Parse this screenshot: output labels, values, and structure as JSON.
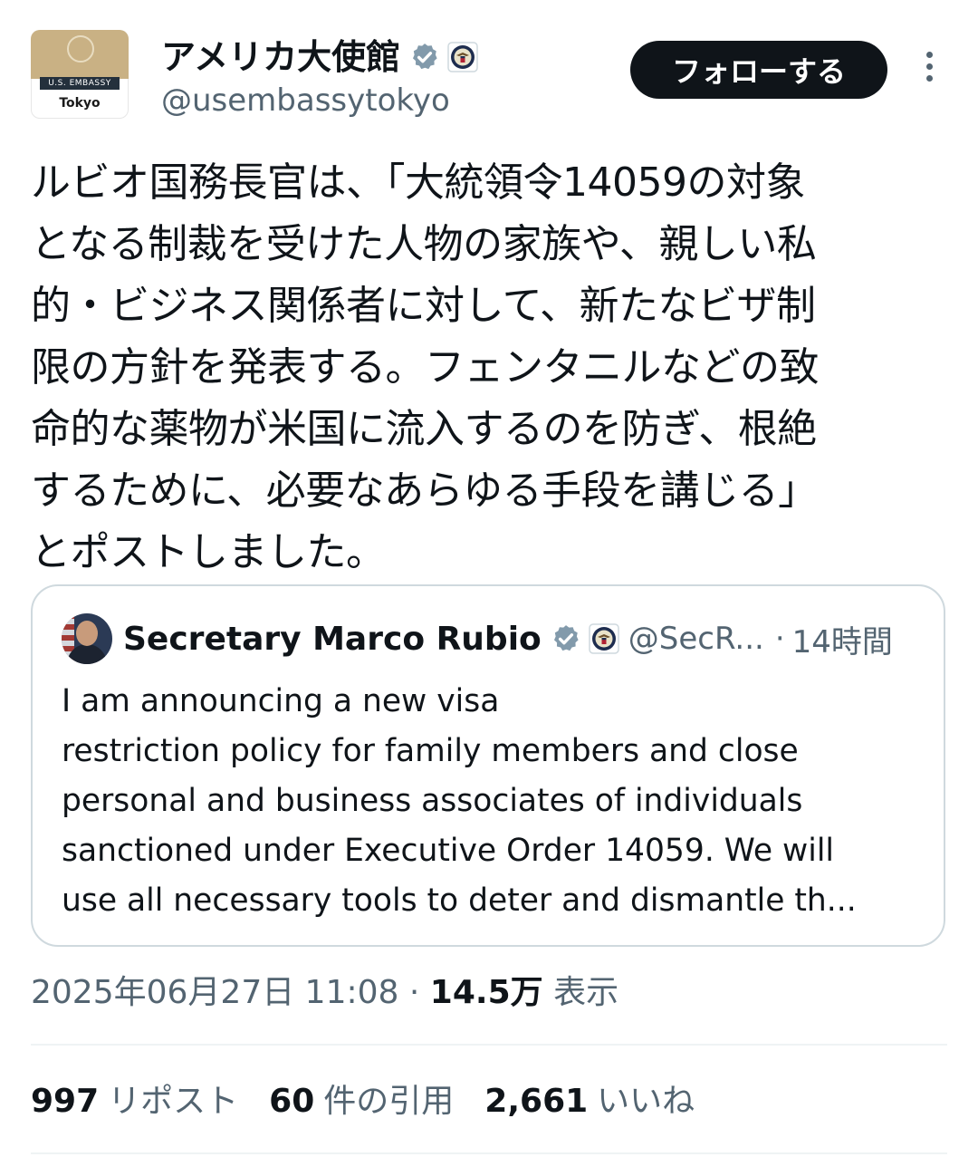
{
  "account": {
    "avatar_band": "U.S. EMBASSY",
    "avatar_city": "Tokyo",
    "display_name": "アメリカ大使館",
    "handle": "@usembassytokyo",
    "follow_label": "フォローする"
  },
  "tweet": {
    "text": "ルビオ国務長官は、「大統領令14059の対象\nとなる制裁を受けた人物の家族や、親しい私\n的・ビジネス関係者に対して、新たなビザ制\n限の方針を発表する。フェンタニルなどの致\n命的な薬物が米国に流入するのを防ぎ、根絶\nするために、必要なあらゆる手段を講じる」\nとポストしました。"
  },
  "quote": {
    "name": "Secretary Marco Rubio",
    "handle": "@SecR...",
    "separator": "·",
    "time": "14時間",
    "text": "I am announcing a new visa\nrestriction policy for family members and close\npersonal and business associates of individuals\nsanctioned under Executive Order 14059. We will\nuse all necessary tools to deter and dismantle th..."
  },
  "meta": {
    "timestamp": "2025年06月27日 11:08",
    "separator": "·",
    "views_count": "14.5万",
    "views_label": "表示"
  },
  "stats": {
    "reposts_count": "997",
    "reposts_label": "リポスト",
    "quotes_count": "60",
    "quotes_label": "件の引用",
    "likes_count": "2,661",
    "likes_label": "いいね"
  },
  "colors": {
    "text_primary": "#0f1419",
    "text_secondary": "#536471",
    "verified_badge": "#829aab",
    "border": "#cfd9de"
  }
}
